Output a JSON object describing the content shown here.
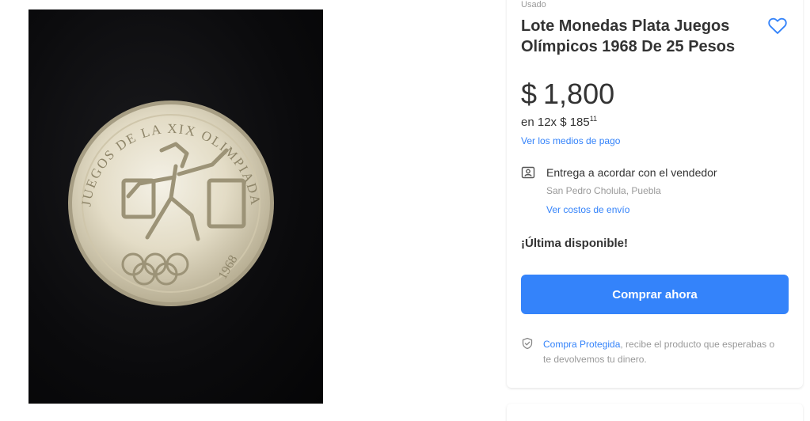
{
  "product": {
    "condition": "Usado",
    "title": "Lote Monedas Plata Juegos Olímpicos 1968 De 25 Pesos",
    "currency": "$",
    "price": "1,800",
    "installments_prefix": "en 12x $ 185",
    "installments_cents": "11",
    "payment_methods_link": "Ver los medios de pago"
  },
  "delivery": {
    "title": "Entrega a acordar con el vendedor",
    "location": "San Pedro Cholula, Puebla",
    "shipping_costs_link": "Ver costos de envío"
  },
  "stock": {
    "label": "¡Última disponible!"
  },
  "actions": {
    "buy_now": "Comprar ahora"
  },
  "protection": {
    "link": "Compra Protegida",
    "text": ", recibe el producto que esperabas o te devolvemos tu dinero."
  },
  "coin": {
    "inscription": "JUEGOS DE LA XIX OLIMPIADA",
    "year": "1968"
  },
  "icons": {
    "favorite": "heart-icon",
    "delivery": "store-pickup-icon",
    "protection": "shield-check-icon"
  },
  "colors": {
    "accent": "#3483fa",
    "text": "#333333",
    "muted": "#999999"
  }
}
